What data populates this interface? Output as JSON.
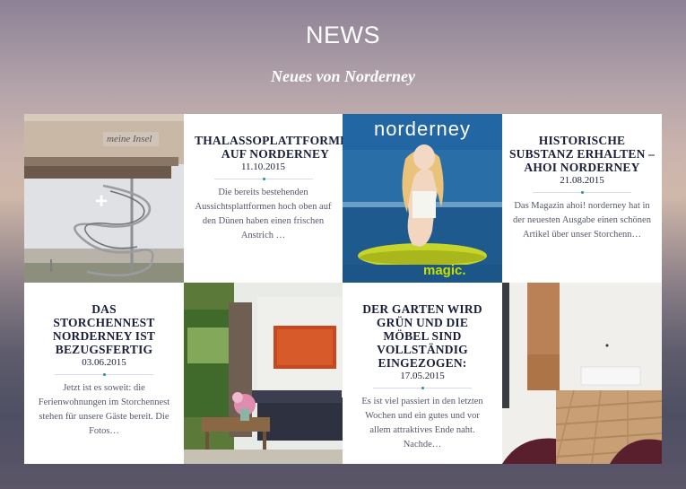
{
  "header": {
    "title": "NEWS",
    "subtitle": "Neues von Norderney"
  },
  "tiles": [
    {
      "kind": "image",
      "image": "spiral-staircase-tower-photo",
      "overlay_icon": "plus-icon",
      "overlay_symbol": "+",
      "sign_text": "meine Insel"
    },
    {
      "kind": "article",
      "title": "THALASSOPLATTFORMEN AUF NORDERNEY",
      "date": "11.10.2015",
      "excerpt": "Die bereits bestehenden Aussichtsplattformen hoch oben auf den Dünen haben einen frischen Anstrich …"
    },
    {
      "kind": "image",
      "image": "magazine-cover-photo",
      "masthead": "norderney",
      "brand": "magic."
    },
    {
      "kind": "article",
      "title": "HISTORISCHE SUBSTANZ ERHALTEN – AHOI NORDERNEY",
      "date": "21.08.2015",
      "excerpt": "Das Magazin ahoi! norderney hat in der neuesten Ausgabe einen schönen Artikel über unser Storchenn…"
    },
    {
      "kind": "article",
      "title": "DAS STORCHENNEST NORDERNEY IST BEZUGSFERTIG",
      "date": "03.06.2015",
      "excerpt": "Jetzt ist es soweit: die Ferienwohnungen im Storchennest stehen für unsere Gäste bereit. Die Fotos…"
    },
    {
      "kind": "image",
      "image": "living-room-photo"
    },
    {
      "kind": "article",
      "title": "DER GARTEN WIRD GRÜN UND DIE MÖBEL SIND VOLLSTÄNDIG EINGEZOGEN:",
      "date": "17.05.2015",
      "excerpt": "Es ist viel passiert in den letzten Wochen und ein gutes und vor allem attraktives Ende naht. Nachde…"
    },
    {
      "kind": "image",
      "image": "empty-room-parquet-photo"
    }
  ],
  "colors": {
    "title": "#1a1f3a",
    "excerpt": "#55596b",
    "accent_dot": "#2a8f8f",
    "card_bg": "#ffffff"
  }
}
